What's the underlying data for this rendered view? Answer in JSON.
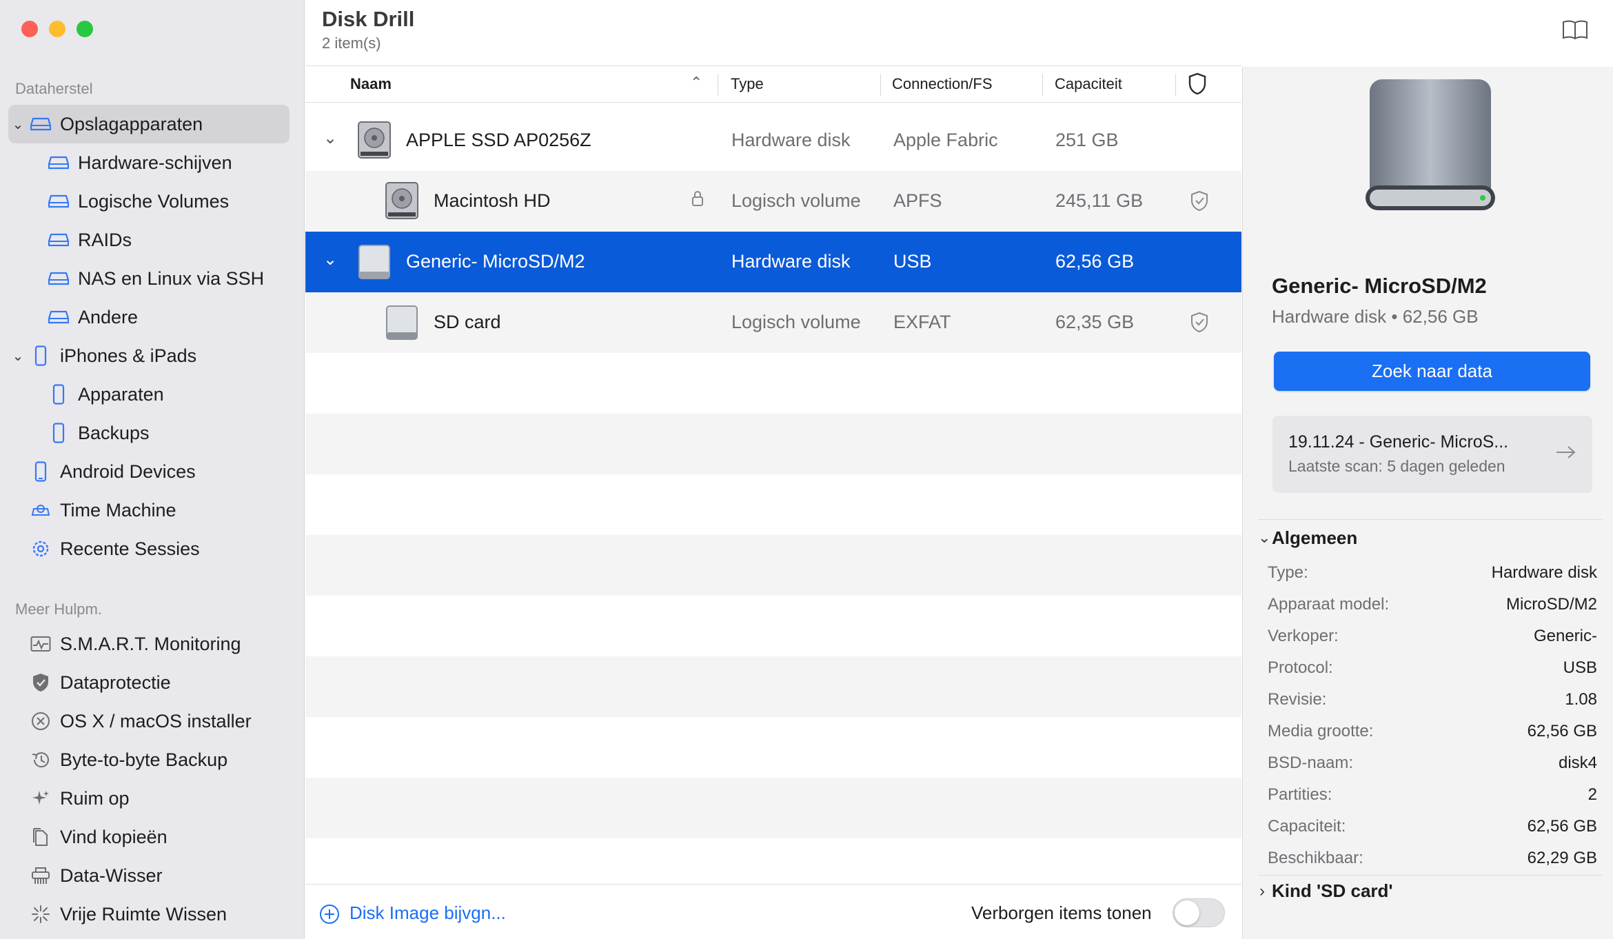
{
  "window": {
    "colors": {
      "close": "#fe5f57",
      "minimize": "#febc2e",
      "zoom": "#28c840",
      "accent": "#0a5bd9"
    }
  },
  "sidebar": {
    "section1": "Dataherstel",
    "section2": "Meer Hulpm.",
    "items": [
      {
        "label": "Opslagapparaten",
        "icon": "drive-icon",
        "selected": true,
        "expanded": true
      },
      {
        "label": "Hardware-schijven",
        "icon": "drive-icon"
      },
      {
        "label": "Logische Volumes",
        "icon": "drive-icon"
      },
      {
        "label": "RAIDs",
        "icon": "drive-icon"
      },
      {
        "label": "NAS en Linux via SSH",
        "icon": "drive-icon"
      },
      {
        "label": "Andere",
        "icon": "drive-icon"
      },
      {
        "label": "iPhones & iPads",
        "icon": "iphone-icon",
        "expanded": true
      },
      {
        "label": "Apparaten",
        "icon": "iphone-icon"
      },
      {
        "label": "Backups",
        "icon": "iphone-icon"
      },
      {
        "label": "Android Devices",
        "icon": "android-icon"
      },
      {
        "label": "Time Machine",
        "icon": "time-machine-icon"
      },
      {
        "label": "Recente Sessies",
        "icon": "gear-icon"
      }
    ],
    "tools": [
      {
        "label": "S.M.A.R.T. Monitoring",
        "icon": "monitoring-icon"
      },
      {
        "label": "Dataprotectie",
        "icon": "shield-icon"
      },
      {
        "label": "OS X / macOS installer",
        "icon": "macos-x-icon"
      },
      {
        "label": "Byte-to-byte Backup",
        "icon": "history-icon"
      },
      {
        "label": "Ruim op",
        "icon": "sparkle-icon"
      },
      {
        "label": "Vind kopieën",
        "icon": "duplicate-icon"
      },
      {
        "label": "Data-Wisser",
        "icon": "shredder-icon"
      },
      {
        "label": "Vrije Ruimte Wissen",
        "icon": "burst-icon"
      }
    ]
  },
  "header": {
    "title": "Disk Drill",
    "subtitle": "2 item(s)"
  },
  "table": {
    "columns": {
      "name": "Naam",
      "type": "Type",
      "conn": "Connection/FS",
      "cap": "Capaciteit"
    },
    "rows": [
      {
        "name": "APPLE SSD AP0256Z",
        "type": "Hardware disk",
        "conn": "Apple Fabric",
        "cap": "251 GB",
        "level": 0,
        "expanded": true,
        "locked": false,
        "protected": false,
        "selected": false
      },
      {
        "name": "Macintosh HD",
        "type": "Logisch volume",
        "conn": "APFS",
        "cap": "245,11 GB",
        "level": 1,
        "locked": true,
        "protected": true,
        "selected": false
      },
      {
        "name": "Generic- MicroSD/M2",
        "type": "Hardware disk",
        "conn": "USB",
        "cap": "62,56 GB",
        "level": 0,
        "expanded": true,
        "locked": false,
        "protected": false,
        "selected": true
      },
      {
        "name": "SD card",
        "type": "Logisch volume",
        "conn": "EXFAT",
        "cap": "62,35 GB",
        "level": 1,
        "locked": false,
        "protected": true,
        "selected": false
      }
    ]
  },
  "bottom": {
    "add_image": "Disk Image bijvgn...",
    "hidden_toggle_label": "Verborgen items tonen",
    "hidden_toggle_on": false
  },
  "details": {
    "device_name": "Generic- MicroSD/M2",
    "device_sub": "Hardware disk • 62,56 GB",
    "scan_button": "Zoek naar data",
    "session_title": "19.11.24 - Generic- MicroS...",
    "session_sub": "Laatste scan: 5 dagen geleden",
    "general_title": "Algemeen",
    "props": [
      {
        "k": "Type:",
        "v": "Hardware disk"
      },
      {
        "k": "Apparaat model:",
        "v": "MicroSD/M2"
      },
      {
        "k": "Verkoper:",
        "v": "Generic-"
      },
      {
        "k": "Protocol:",
        "v": "USB"
      },
      {
        "k": "Revisie:",
        "v": "1.08"
      },
      {
        "k": "Media grootte:",
        "v": "62,56 GB"
      },
      {
        "k": "BSD-naam:",
        "v": "disk4"
      },
      {
        "k": "Partities:",
        "v": "2"
      },
      {
        "k": "Capaciteit:",
        "v": "62,56 GB"
      },
      {
        "k": "Beschikbaar:",
        "v": "62,29 GB"
      }
    ],
    "child_title": "Kind 'SD card'"
  }
}
